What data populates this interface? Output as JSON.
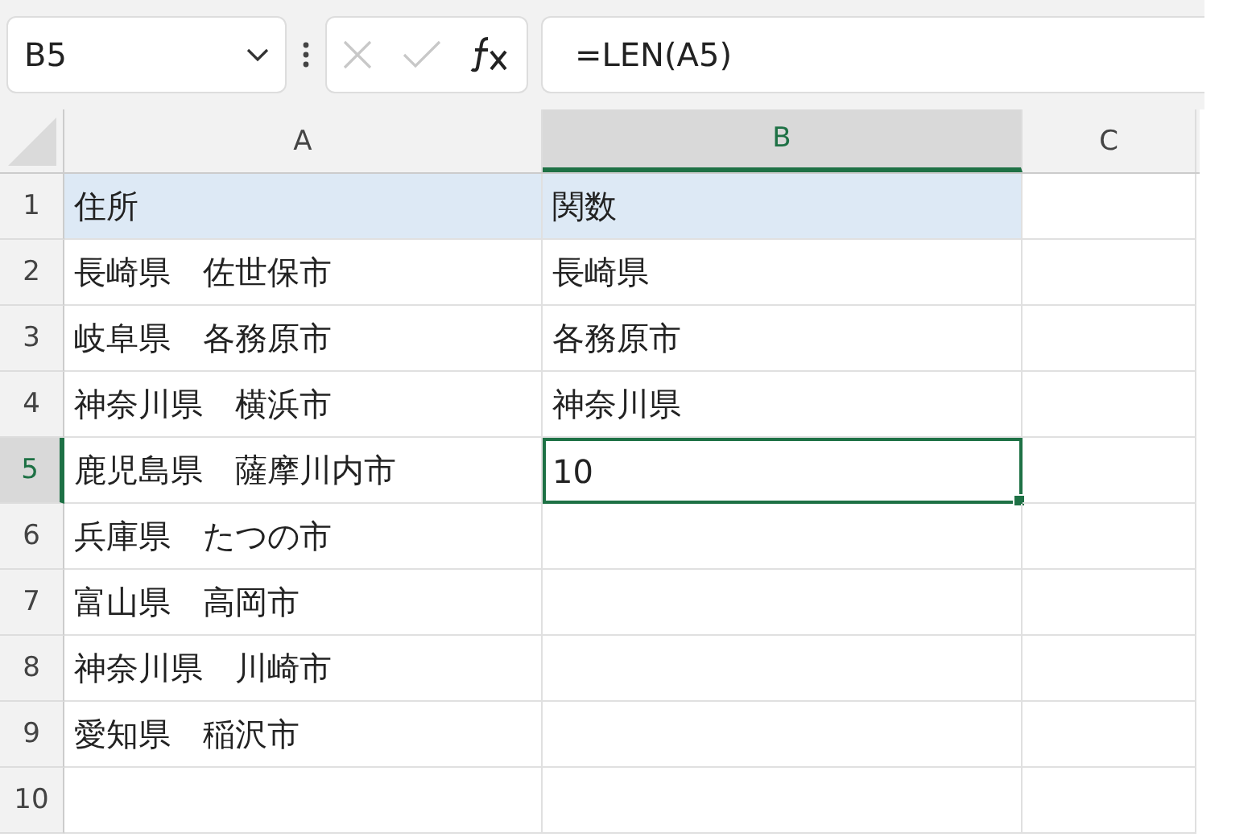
{
  "name_box": {
    "value": "B5"
  },
  "formula_bar": {
    "value": "=LEN(A5)"
  },
  "columns": [
    {
      "label": "A",
      "selected": false
    },
    {
      "label": "B",
      "selected": true
    },
    {
      "label": "C",
      "selected": false
    }
  ],
  "rows": [
    {
      "label": "1",
      "selected": false,
      "highlighted": true,
      "cells": [
        {
          "value": "住所",
          "selected": false
        },
        {
          "value": "関数",
          "selected": false
        }
      ]
    },
    {
      "label": "2",
      "selected": false,
      "highlighted": false,
      "cells": [
        {
          "value": "長崎県　佐世保市",
          "selected": false
        },
        {
          "value": "長崎県",
          "selected": false
        }
      ]
    },
    {
      "label": "3",
      "selected": false,
      "highlighted": false,
      "cells": [
        {
          "value": "岐阜県　各務原市",
          "selected": false
        },
        {
          "value": "各務原市",
          "selected": false
        }
      ]
    },
    {
      "label": "4",
      "selected": false,
      "highlighted": false,
      "cells": [
        {
          "value": "神奈川県　横浜市",
          "selected": false
        },
        {
          "value": "神奈川県",
          "selected": false
        }
      ]
    },
    {
      "label": "5",
      "selected": true,
      "highlighted": false,
      "cells": [
        {
          "value": "鹿児島県　薩摩川内市",
          "selected": false
        },
        {
          "value": "10",
          "selected": true
        }
      ]
    },
    {
      "label": "6",
      "selected": false,
      "highlighted": false,
      "cells": [
        {
          "value": "兵庫県　たつの市",
          "selected": false
        }
      ]
    },
    {
      "label": "7",
      "selected": false,
      "highlighted": false,
      "cells": [
        {
          "value": "富山県　高岡市",
          "selected": false
        }
      ]
    },
    {
      "label": "8",
      "selected": false,
      "highlighted": false,
      "cells": [
        {
          "value": "神奈川県　川崎市",
          "selected": false
        }
      ]
    },
    {
      "label": "9",
      "selected": false,
      "highlighted": false,
      "cells": [
        {
          "value": "愛知県　稲沢市",
          "selected": false
        }
      ]
    },
    {
      "label": "10",
      "selected": false,
      "highlighted": false
    }
  ]
}
